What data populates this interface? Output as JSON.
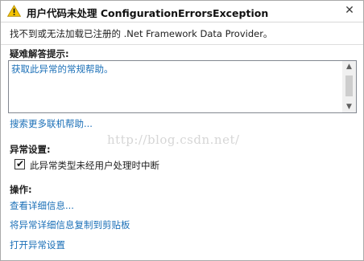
{
  "title": "用户代码未处理 ConfigurationErrorsException",
  "message": "找不到或无法加载已注册的 .Net Framework Data Provider。",
  "troubleshooting": {
    "label": "疑难解答提示:",
    "tip_text": "获取此异常的常规帮助。",
    "search_link": "搜索更多联机帮助..."
  },
  "watermark": "http://blog.csdn.net/",
  "exception_settings": {
    "label": "异常设置:",
    "checkbox_label": "此异常类型未经用户处理时中断",
    "checked": true
  },
  "actions": {
    "label": "操作:",
    "view_details": "查看详细信息...",
    "copy_details": "将异常详细信息复制到剪贴板",
    "open_settings": "打开异常设置"
  },
  "icons": {
    "title_icon": "warning-icon",
    "close": "close-icon",
    "scroll_up": "scroll-up-arrow-icon",
    "scroll_down": "scroll-down-arrow-icon",
    "check": "checkmark-icon"
  },
  "colors": {
    "link": "#1a6fb7",
    "warning_fill": "#f5c400",
    "text": "#1e1e1e"
  }
}
